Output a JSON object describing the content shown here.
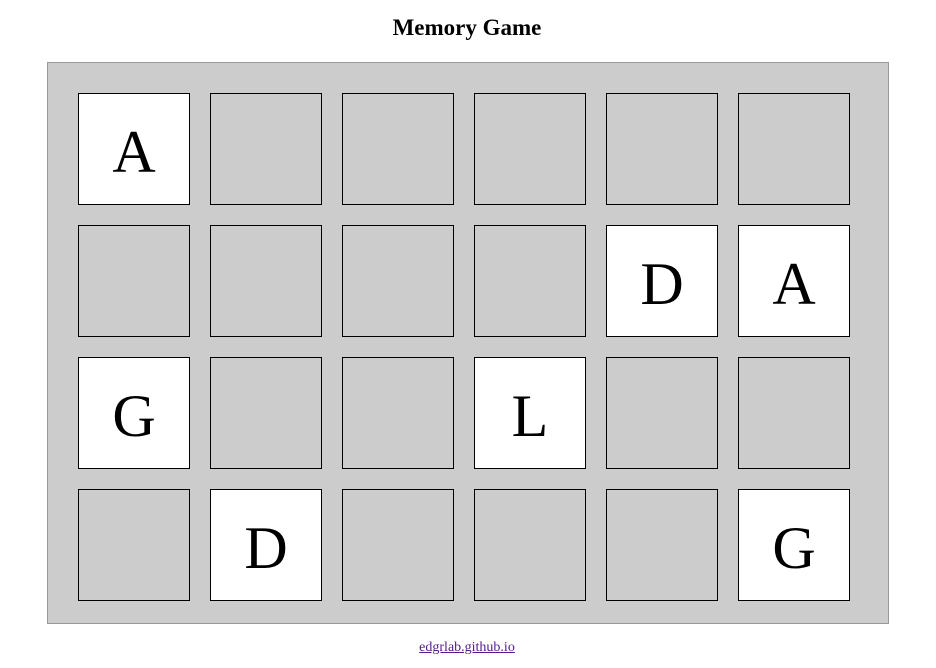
{
  "title": "Memory Game",
  "footer_link": "edgrlab.github.io",
  "colors": {
    "board_bg": "#cccccc",
    "card_hidden": "#cccccc",
    "card_revealed": "#ffffff",
    "link": "#551a8b"
  },
  "grid": {
    "rows": 4,
    "cols": 6,
    "cards": [
      {
        "letter": "A",
        "revealed": true
      },
      {
        "letter": "",
        "revealed": false
      },
      {
        "letter": "",
        "revealed": false
      },
      {
        "letter": "",
        "revealed": false
      },
      {
        "letter": "",
        "revealed": false
      },
      {
        "letter": "",
        "revealed": false
      },
      {
        "letter": "",
        "revealed": false
      },
      {
        "letter": "",
        "revealed": false
      },
      {
        "letter": "",
        "revealed": false
      },
      {
        "letter": "",
        "revealed": false
      },
      {
        "letter": "D",
        "revealed": true
      },
      {
        "letter": "A",
        "revealed": true
      },
      {
        "letter": "G",
        "revealed": true
      },
      {
        "letter": "",
        "revealed": false
      },
      {
        "letter": "",
        "revealed": false
      },
      {
        "letter": "L",
        "revealed": true
      },
      {
        "letter": "",
        "revealed": false
      },
      {
        "letter": "",
        "revealed": false
      },
      {
        "letter": "",
        "revealed": false
      },
      {
        "letter": "D",
        "revealed": true
      },
      {
        "letter": "",
        "revealed": false
      },
      {
        "letter": "",
        "revealed": false
      },
      {
        "letter": "",
        "revealed": false
      },
      {
        "letter": "G",
        "revealed": true
      }
    ]
  }
}
